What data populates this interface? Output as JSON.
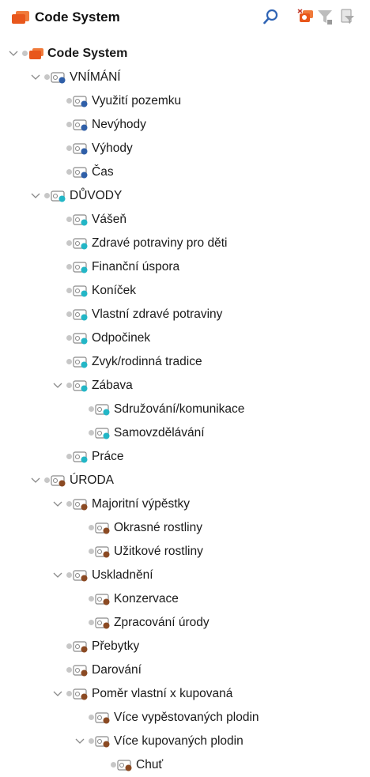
{
  "header": {
    "title": "Code System",
    "buttons": [
      {
        "icon": "search-icon"
      },
      {
        "icon": "code-system-settings-icon"
      },
      {
        "icon": "filter-icon"
      },
      {
        "icon": "filter-document-icon"
      }
    ]
  },
  "colors": {
    "root": "#e8571c",
    "vnimani": "#2f5fa8",
    "duvody": "#23b6c6",
    "uroda": "#8b4a23",
    "connector_dot": "#c7c7c7",
    "twisty": "#8a8a8a"
  },
  "tree": [
    {
      "label": "Code System",
      "level": 0,
      "expanded": true,
      "root": true,
      "icon": "code-system-icon"
    },
    {
      "label": "VNÍMÁNÍ",
      "level": 1,
      "expanded": true,
      "color": "vnimani",
      "icon": "code-icon"
    },
    {
      "label": "Využití pozemku",
      "level": 2,
      "color": "vnimani",
      "icon": "code-icon"
    },
    {
      "label": "Nevýhody",
      "level": 2,
      "color": "vnimani",
      "icon": "code-icon"
    },
    {
      "label": "Výhody",
      "level": 2,
      "color": "vnimani",
      "icon": "code-icon"
    },
    {
      "label": "Čas",
      "level": 2,
      "color": "vnimani",
      "icon": "code-icon"
    },
    {
      "label": "DŮVODY",
      "level": 1,
      "expanded": true,
      "color": "duvody",
      "icon": "code-icon"
    },
    {
      "label": "Vášeň",
      "level": 2,
      "color": "duvody",
      "icon": "code-icon"
    },
    {
      "label": "Zdravé potraviny pro děti",
      "level": 2,
      "color": "duvody",
      "icon": "code-icon"
    },
    {
      "label": "Finanční úspora",
      "level": 2,
      "color": "duvody",
      "icon": "code-icon"
    },
    {
      "label": "Koníček",
      "level": 2,
      "color": "duvody",
      "icon": "code-icon"
    },
    {
      "label": "Vlastní zdravé potraviny",
      "level": 2,
      "color": "duvody",
      "icon": "code-icon"
    },
    {
      "label": "Odpočinek",
      "level": 2,
      "color": "duvody",
      "icon": "code-icon"
    },
    {
      "label": "Zvyk/rodinná tradice",
      "level": 2,
      "color": "duvody",
      "icon": "code-icon"
    },
    {
      "label": "Zábava",
      "level": 2,
      "expanded": true,
      "color": "duvody",
      "icon": "code-icon"
    },
    {
      "label": "Sdružování/komunikace",
      "level": 3,
      "color": "duvody",
      "icon": "code-icon"
    },
    {
      "label": "Samovzdělávání",
      "level": 3,
      "color": "duvody",
      "icon": "code-icon"
    },
    {
      "label": "Práce",
      "level": 2,
      "color": "duvody",
      "icon": "code-icon"
    },
    {
      "label": "ÚRODA",
      "level": 1,
      "expanded": true,
      "color": "uroda",
      "icon": "code-icon"
    },
    {
      "label": "Majoritní výpěstky",
      "level": 2,
      "expanded": true,
      "color": "uroda",
      "icon": "code-icon"
    },
    {
      "label": "Okrasné rostliny",
      "level": 3,
      "color": "uroda",
      "icon": "code-icon"
    },
    {
      "label": "Užitkové rostliny",
      "level": 3,
      "color": "uroda",
      "icon": "code-icon"
    },
    {
      "label": "Uskladnění",
      "level": 2,
      "expanded": true,
      "color": "uroda",
      "icon": "code-icon"
    },
    {
      "label": "Konzervace",
      "level": 3,
      "color": "uroda",
      "icon": "code-icon"
    },
    {
      "label": "Zpracování úrody",
      "level": 3,
      "color": "uroda",
      "icon": "code-icon"
    },
    {
      "label": "Přebytky",
      "level": 2,
      "color": "uroda",
      "icon": "code-icon"
    },
    {
      "label": "Darování",
      "level": 2,
      "color": "uroda",
      "icon": "code-icon"
    },
    {
      "label": "Poměr vlastní x kupovaná",
      "level": 2,
      "expanded": true,
      "color": "uroda",
      "icon": "code-icon"
    },
    {
      "label": "Více vypěstovaných plodin",
      "level": 3,
      "color": "uroda",
      "icon": "code-icon"
    },
    {
      "label": "Více kupovaných plodin",
      "level": 3,
      "expanded": true,
      "color": "uroda",
      "icon": "code-icon"
    },
    {
      "label": "Chuť",
      "level": 4,
      "color": "uroda",
      "icon": "code-icon"
    }
  ]
}
